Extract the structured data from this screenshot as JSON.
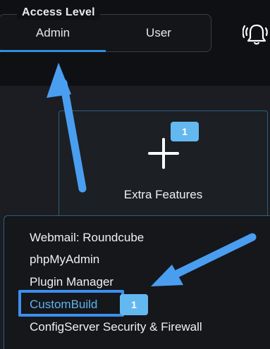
{
  "access_level": {
    "legend": "Access Level",
    "tabs": [
      {
        "label": "Admin",
        "selected": true
      },
      {
        "label": "User",
        "selected": false
      }
    ]
  },
  "extra_features": {
    "title": "Extra Features",
    "badge": "1",
    "icon": "plus-icon"
  },
  "menu": {
    "items": [
      {
        "label": "Webmail: Roundcube"
      },
      {
        "label": "phpMyAdmin"
      },
      {
        "label": "Plugin Manager"
      },
      {
        "label": "CustomBuild",
        "highlighted": true,
        "badge": "1"
      },
      {
        "label": "ConfigServer Security & Firewall"
      }
    ]
  },
  "icons": {
    "notifications": "bell-alert-icon"
  },
  "colors": {
    "accent": "#3d8ff0",
    "highlight_text": "#5fb4f0",
    "badge": "#64b8f0",
    "background": "#111317"
  }
}
